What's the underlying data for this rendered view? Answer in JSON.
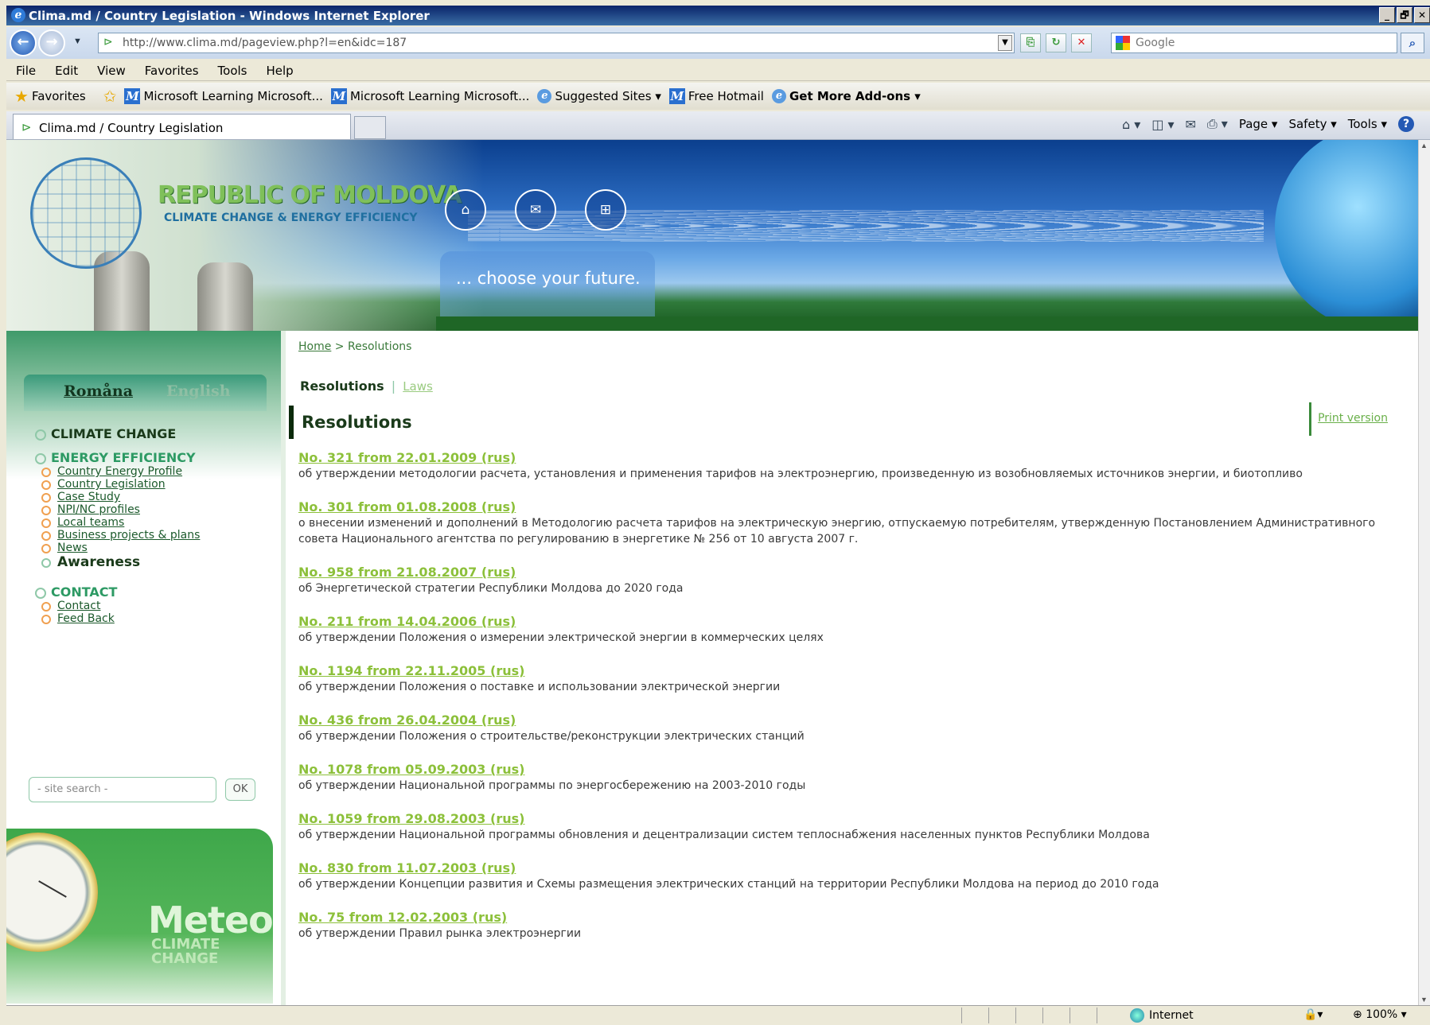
{
  "window": {
    "title": "Clima.md / Country Legislation - Windows Internet Explorer",
    "buttons": [
      "_",
      "🗗",
      "✕"
    ]
  },
  "address_bar": {
    "url": "http://www.clima.md/pageview.php?l=en&idc=187",
    "search_placeholder": "Google"
  },
  "menu": [
    "File",
    "Edit",
    "View",
    "Favorites",
    "Tools",
    "Help"
  ],
  "favorites_bar": {
    "favorites_label": "Favorites",
    "items": [
      {
        "label": "Microsoft Learning Microsoft...",
        "icon": "msn-icon"
      },
      {
        "label": "Microsoft Learning Microsoft...",
        "icon": "msn-icon"
      },
      {
        "label": "Suggested Sites ▾",
        "icon": "ie-icon"
      },
      {
        "label": "Free Hotmail",
        "icon": "msn-icon"
      },
      {
        "label": "Get More Add-ons ▾",
        "icon": "ie-icon"
      }
    ]
  },
  "tab": {
    "title": "Clima.md / Country Legislation"
  },
  "command_bar": {
    "page": "Page ▾",
    "safety": "Safety ▾",
    "tools": "Tools ▾"
  },
  "banner": {
    "title": "REPUBLIC OF MOLDOVA",
    "subtitle": "CLIMATE CHANGE & ENERGY EFFICIENCY",
    "tagline": "... choose your future."
  },
  "languages": {
    "ro": "Romåna",
    "en": "English"
  },
  "nav": {
    "climate_change": "CLIMATE CHANGE",
    "energy_efficiency": "ENERGY EFFICIENCY",
    "ee_items": [
      "Country Energy Profile",
      "Country Legislation",
      "Case Study",
      "NPI/NC profiles",
      "Local teams",
      "Business projects & plans",
      "News"
    ],
    "awareness": "Awareness",
    "contact": "CONTACT",
    "contact_items": [
      "Contact",
      "Feed Back"
    ]
  },
  "search": {
    "placeholder": "- site search -",
    "ok": "OK"
  },
  "meteo": {
    "title": "Meteo",
    "sub1": "CLIMATE",
    "sub2": "CHANGE"
  },
  "content": {
    "breadcrumb_home": "Home",
    "breadcrumb_current": "> Resolutions",
    "subtab_active": "Resolutions",
    "subtab_sep": "|",
    "subtab_link": "Laws",
    "page_title": "Resolutions",
    "print_version": "Print version",
    "resolutions": [
      {
        "title": "No. 321 from 22.01.2009 (rus)",
        "desc": "об утверждении методологии расчета, установления и применения тарифов на электроэнергию, произведенную из возобновляемых источников энергии, и биотопливо"
      },
      {
        "title": "No. 301 from 01.08.2008 (rus)",
        "desc": "о внесении изменений и дополнений в Методологию расчета тарифов на электрическую энергию, отпускаемую потребителям, утвержденную Постановлением Административного совета Национального агентства по регулированию в энергетике № 256 от 10 августа 2007 г."
      },
      {
        "title": "No. 958 from 21.08.2007 (rus)",
        "desc": "об Энергетической стратегии Республики Молдова до 2020 года"
      },
      {
        "title": "No. 211 from 14.04.2006 (rus)",
        "desc": "об утверждении Положения о измерении электрической энергии в коммерческих целях"
      },
      {
        "title": "No. 1194 from 22.11.2005 (rus)",
        "desc": "об утверждении Положения о поставке и использовании электрической энергии"
      },
      {
        "title": "No. 436 from 26.04.2004 (rus)",
        "desc": "об утверждении Положения о строительстве/реконструкции электрических станций"
      },
      {
        "title": "No. 1078 from 05.09.2003 (rus)",
        "desc": "об утверждении Национальной программы по энергосбережению на 2003-2010 годы"
      },
      {
        "title": "No. 1059 from 29.08.2003 (rus)",
        "desc": "об утверждении Национальной программы обновления и децентрализации систем теплоснабжения населенных пунктов Республики Молдова"
      },
      {
        "title": "No. 830 from 11.07.2003 (rus)",
        "desc": "об утверждении Концепции развития и Схемы размещения электрических станций на территории Республики Молдова на период до 2010 года"
      },
      {
        "title": "No. 75 from 12.02.2003 (rus)",
        "desc": "об утверждении Правил рынка электроэнергии"
      }
    ]
  },
  "status_bar": {
    "zone": "Internet",
    "zoom": "100%"
  }
}
